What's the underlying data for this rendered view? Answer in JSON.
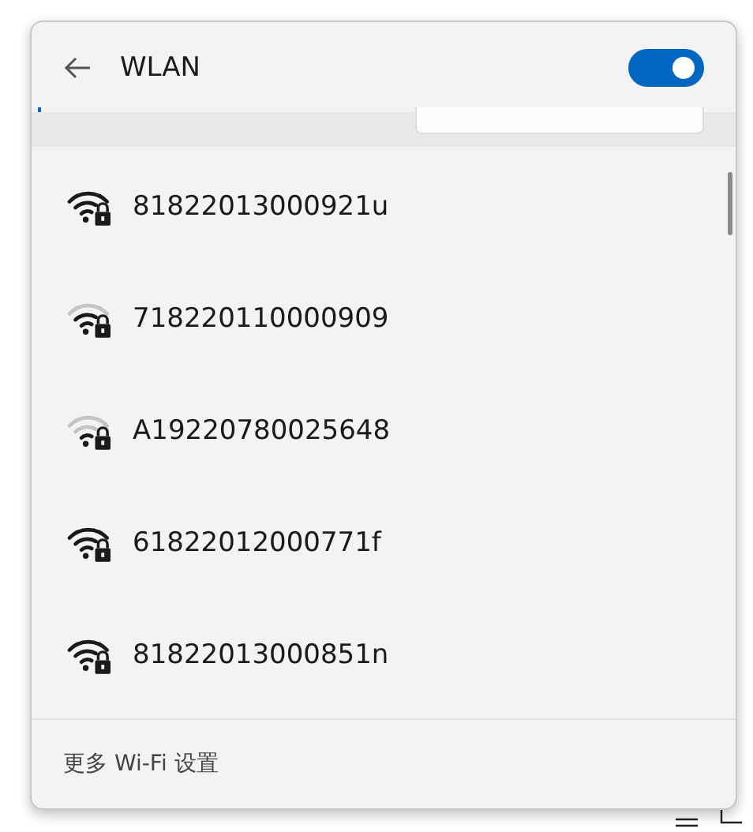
{
  "header": {
    "title": "WLAN",
    "wifi_on": true
  },
  "networks": [
    {
      "ssid": "81822013000921u",
      "kind": "strong",
      "secured": true
    },
    {
      "ssid": "718220110000909",
      "kind": "medium",
      "secured": true
    },
    {
      "ssid": "A19220780025648",
      "kind": "weak",
      "secured": true
    },
    {
      "ssid": "61822012000771f",
      "kind": "strong",
      "secured": true
    },
    {
      "ssid": "81822013000851n",
      "kind": "strong",
      "secured": true
    }
  ],
  "footer": {
    "link": "更多 Wi-Fi 设置"
  }
}
